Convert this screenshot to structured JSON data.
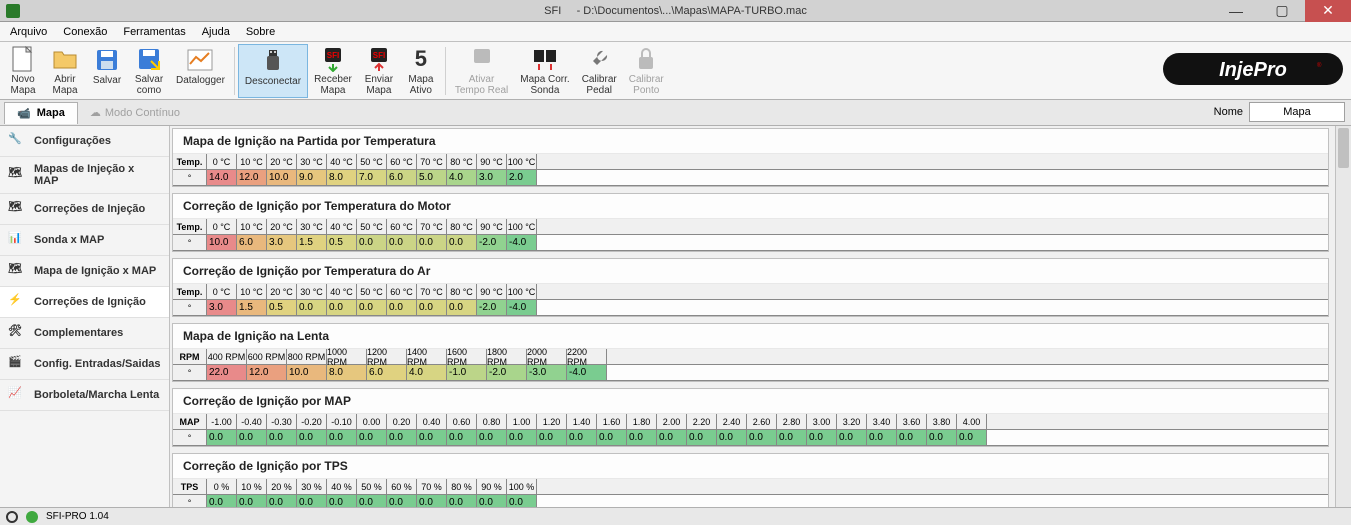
{
  "title": {
    "app": "SFI",
    "path": "- D:\\Documentos\\...\\Mapas\\MAPA-TURBO.mac"
  },
  "menu": {
    "arquivo": "Arquivo",
    "conexao": "Conexão",
    "ferramentas": "Ferramentas",
    "ajuda": "Ajuda",
    "sobre": "Sobre"
  },
  "toolbar": {
    "novo": "Novo\nMapa",
    "abrir": "Abrir\nMapa",
    "salvar": "Salvar",
    "salvarcomo": "Salvar\ncomo",
    "datalogger": "Datalogger",
    "desconectar": "Desconectar",
    "receber": "Receber\nMapa",
    "enviar": "Enviar\nMapa",
    "mapaativo": "Mapa\nAtivo",
    "mapaativonum": "5",
    "tempo": "Ativar\nTempo Real",
    "sonda": "Mapa Corr.\nSonda",
    "pedal": "Calibrar\nPedal",
    "ponto": "Calibrar\nPonto"
  },
  "tabs": {
    "mapa": "Mapa",
    "modo": "Modo Contínuo",
    "nome_label": "Nome",
    "nome_value": "Mapa"
  },
  "sidebar": {
    "items": [
      {
        "label": "Configurações"
      },
      {
        "label": "Mapas de Injeção x MAP"
      },
      {
        "label": "Correções de Injeção"
      },
      {
        "label": "Sonda x MAP"
      },
      {
        "label": "Mapa de Ignição x MAP"
      },
      {
        "label": "Correções de Ignição"
      },
      {
        "label": "Complementares"
      },
      {
        "label": "Config. Entradas/Saidas"
      },
      {
        "label": "Borboleta/Marcha Lenta"
      }
    ]
  },
  "sections": [
    {
      "title": "Mapa de Ignição na Partida por Temperatura",
      "rowlabel": "Temp.",
      "unit": "°",
      "headers": [
        "0 °C",
        "10 °C",
        "20 °C",
        "30 °C",
        "40 °C",
        "50 °C",
        "60 °C",
        "70 °C",
        "80 °C",
        "90 °C",
        "100 °C"
      ],
      "values": [
        "14.0",
        "12.0",
        "10.0",
        "9.0",
        "8.0",
        "7.0",
        "6.0",
        "5.0",
        "4.0",
        "3.0",
        "2.0"
      ],
      "colors": [
        "c-r1",
        "c-r2",
        "c-o1",
        "c-o2",
        "c-y1",
        "c-y2",
        "c-g4",
        "c-g3",
        "c-g2",
        "c-g1",
        "c-g0"
      ]
    },
    {
      "title": "Correção de Ignição por Temperatura do Motor",
      "rowlabel": "Temp.",
      "unit": "°",
      "headers": [
        "0 °C",
        "10 °C",
        "20 °C",
        "30 °C",
        "40 °C",
        "50 °C",
        "60 °C",
        "70 °C",
        "80 °C",
        "90 °C",
        "100 °C"
      ],
      "values": [
        "10.0",
        "6.0",
        "3.0",
        "1.5",
        "0.5",
        "0.0",
        "0.0",
        "0.0",
        "0.0",
        "-2.0",
        "-4.0"
      ],
      "colors": [
        "c-r1",
        "c-o1",
        "c-o2",
        "c-y1",
        "c-y2",
        "c-g4",
        "c-g4",
        "c-g4",
        "c-g4",
        "c-g1",
        "c-g0"
      ]
    },
    {
      "title": "Correção de Ignição por Temperatura do Ar",
      "rowlabel": "Temp.",
      "unit": "°",
      "headers": [
        "0 °C",
        "10 °C",
        "20 °C",
        "30 °C",
        "40 °C",
        "50 °C",
        "60 °C",
        "70 °C",
        "80 °C",
        "90 °C",
        "100 °C"
      ],
      "values": [
        "3.0",
        "1.5",
        "0.5",
        "0.0",
        "0.0",
        "0.0",
        "0.0",
        "0.0",
        "0.0",
        "-2.0",
        "-4.0"
      ],
      "colors": [
        "c-r1",
        "c-o1",
        "c-y1",
        "c-y2",
        "c-y2",
        "c-y2",
        "c-y2",
        "c-y2",
        "c-y2",
        "c-g1",
        "c-g0"
      ]
    },
    {
      "title": "Mapa de Ignição na Lenta",
      "rowlabel": "RPM",
      "unit": "°",
      "wide": true,
      "headers": [
        "400 RPM",
        "600 RPM",
        "800 RPM",
        "1000 RPM",
        "1200 RPM",
        "1400 RPM",
        "1600 RPM",
        "1800 RPM",
        "2000 RPM",
        "2200 RPM"
      ],
      "values": [
        "22.0",
        "12.0",
        "10.0",
        "8.0",
        "6.0",
        "4.0",
        "-1.0",
        "-2.0",
        "-3.0",
        "-4.0"
      ],
      "colors": [
        "c-r1",
        "c-r2",
        "c-o1",
        "c-o2",
        "c-y1",
        "c-y2",
        "c-g3",
        "c-g2",
        "c-g1",
        "c-g0"
      ]
    },
    {
      "title": "Correção de Ignição por MAP",
      "rowlabel": "MAP",
      "unit": "°",
      "headers": [
        "-1.00",
        "-0.40",
        "-0.30",
        "-0.20",
        "-0.10",
        "0.00",
        "0.20",
        "0.40",
        "0.60",
        "0.80",
        "1.00",
        "1.20",
        "1.40",
        "1.60",
        "1.80",
        "2.00",
        "2.20",
        "2.40",
        "2.60",
        "2.80",
        "3.00",
        "3.20",
        "3.40",
        "3.60",
        "3.80",
        "4.00"
      ],
      "values": [
        "0.0",
        "0.0",
        "0.0",
        "0.0",
        "0.0",
        "0.0",
        "0.0",
        "0.0",
        "0.0",
        "0.0",
        "0.0",
        "0.0",
        "0.0",
        "0.0",
        "0.0",
        "0.0",
        "0.0",
        "0.0",
        "0.0",
        "0.0",
        "0.0",
        "0.0",
        "0.0",
        "0.0",
        "0.0",
        "0.0"
      ],
      "colors": [
        "c-g0",
        "c-g0",
        "c-g0",
        "c-g0",
        "c-g0",
        "c-g0",
        "c-g0",
        "c-g0",
        "c-g0",
        "c-g0",
        "c-g0",
        "c-g0",
        "c-g0",
        "c-g0",
        "c-g0",
        "c-g0",
        "c-g0",
        "c-g0",
        "c-g0",
        "c-g0",
        "c-g0",
        "c-g0",
        "c-g0",
        "c-g0",
        "c-g0",
        "c-g0"
      ]
    },
    {
      "title": "Correção de Ignição por TPS",
      "rowlabel": "TPS",
      "unit": "°",
      "headers": [
        "0 %",
        "10 %",
        "20 %",
        "30 %",
        "40 %",
        "50 %",
        "60 %",
        "70 %",
        "80 %",
        "90 %",
        "100 %"
      ],
      "values": [
        "0.0",
        "0.0",
        "0.0",
        "0.0",
        "0.0",
        "0.0",
        "0.0",
        "0.0",
        "0.0",
        "0.0",
        "0.0"
      ],
      "colors": [
        "c-g0",
        "c-g0",
        "c-g0",
        "c-g0",
        "c-g0",
        "c-g0",
        "c-g0",
        "c-g0",
        "c-g0",
        "c-g0",
        "c-g0"
      ]
    }
  ],
  "status": {
    "version": "SFI-PRO 1.04"
  }
}
